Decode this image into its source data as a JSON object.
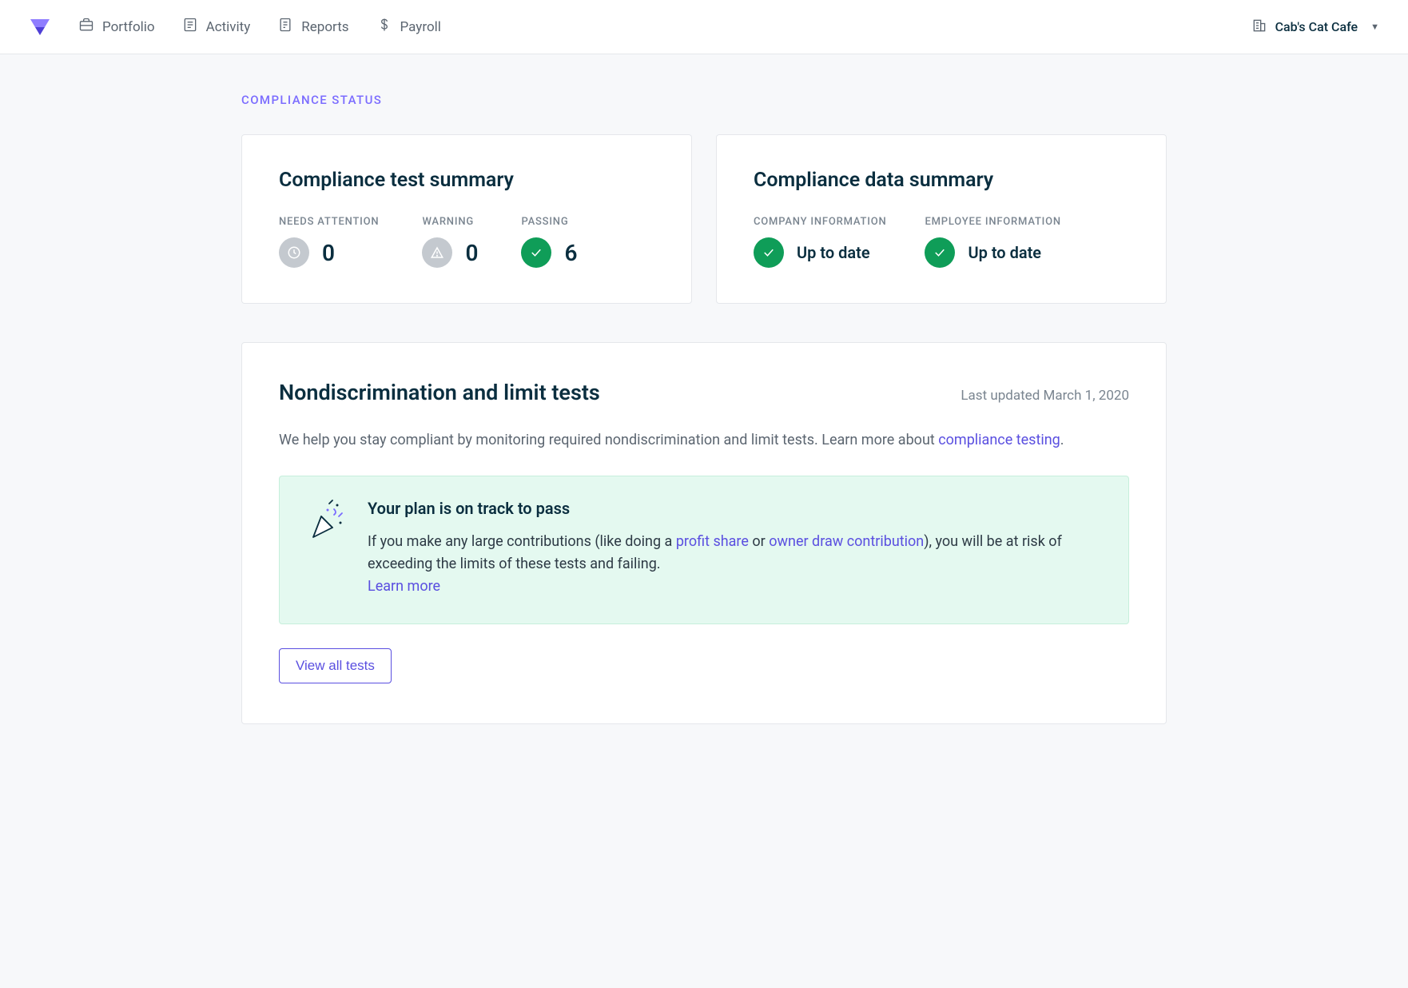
{
  "nav": {
    "items": [
      {
        "label": "Portfolio"
      },
      {
        "label": "Activity"
      },
      {
        "label": "Reports"
      },
      {
        "label": "Payroll"
      }
    ]
  },
  "company": {
    "name": "Cab's Cat Cafe"
  },
  "section_label": "COMPLIANCE STATUS",
  "test_summary": {
    "title": "Compliance test summary",
    "metrics": [
      {
        "label": "NEEDS ATTENTION",
        "value": "0"
      },
      {
        "label": "WARNING",
        "value": "0"
      },
      {
        "label": "PASSING",
        "value": "6"
      }
    ]
  },
  "data_summary": {
    "title": "Compliance data summary",
    "items": [
      {
        "label": "COMPANY INFORMATION",
        "status": "Up to date"
      },
      {
        "label": "EMPLOYEE INFORMATION",
        "status": "Up to date"
      }
    ]
  },
  "tests": {
    "title": "Nondiscrimination and limit tests",
    "updated": "Last updated March 1, 2020",
    "description_prefix": "We help you stay compliant by monitoring required nondiscrimination and limit tests. Learn more about ",
    "description_link": "compliance testing",
    "description_suffix": ".",
    "notice": {
      "title": "Your plan is on track to pass",
      "text_1": "If you make any large contributions (like doing a ",
      "link_1": "profit share",
      "text_2": " or ",
      "link_2": "owner draw contribution",
      "text_3": "), you will be at risk of exceeding the limits of these tests and failing.",
      "learn_more": "Learn more"
    },
    "button": "View all tests"
  }
}
